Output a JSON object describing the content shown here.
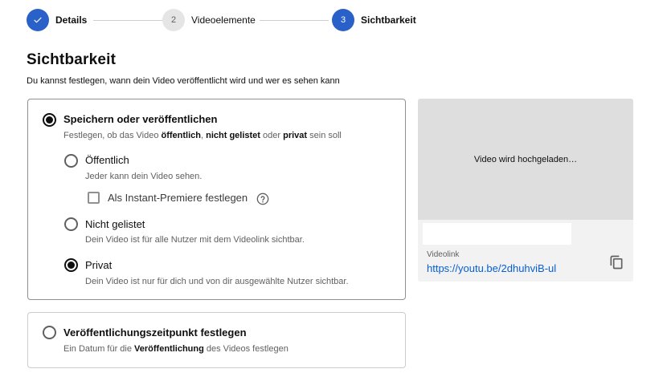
{
  "stepper": {
    "steps": [
      {
        "number": "✓",
        "label": "Details",
        "state": "done"
      },
      {
        "number": "2",
        "label": "Videoelemente",
        "state": "pending"
      },
      {
        "number": "3",
        "label": "Sichtbarkeit",
        "state": "active"
      }
    ]
  },
  "heading": {
    "title": "Sichtbarkeit",
    "subtitle": "Du kannst festlegen, wann dein Video veröffentlicht wird und wer es sehen kann"
  },
  "save_publish": {
    "title": "Speichern oder veröffentlichen",
    "desc_prefix": "Festlegen, ob das Video ",
    "desc_bold1": "öffentlich",
    "desc_sep1": ", ",
    "desc_bold2": "nicht gelistet",
    "desc_mid": " oder ",
    "desc_bold3": "privat",
    "desc_suffix": " sein soll",
    "selected": true,
    "options": {
      "public": {
        "title": "Öffentlich",
        "desc": "Jeder kann dein Video sehen.",
        "selected": false
      },
      "premiere": {
        "label": "Als Instant-Premiere festlegen",
        "checked": false,
        "icon": "help-icon"
      },
      "unlisted": {
        "title": "Nicht gelistet",
        "desc": "Dein Video ist für alle Nutzer mit dem Videolink sichtbar.",
        "selected": false
      },
      "private": {
        "title": "Privat",
        "desc": "Dein Video ist nur für dich und von dir ausgewählte Nutzer sichtbar.",
        "selected": true
      }
    }
  },
  "schedule": {
    "title": "Veröffentlichungszeitpunkt festlegen",
    "desc_prefix": "Ein Datum für die ",
    "desc_bold": "Veröffentlichung",
    "desc_suffix": " des Videos festlegen",
    "selected": false
  },
  "preview": {
    "status": "Video wird hochgeladen…",
    "link_label": "Videolink",
    "link_url": "https://youtu.be/2dhuhviB-ul",
    "copy_icon": "copy-icon"
  },
  "colors": {
    "accent": "#2a61c9",
    "link": "#065fd4",
    "text": "#0f0f0f",
    "muted": "#606060"
  }
}
